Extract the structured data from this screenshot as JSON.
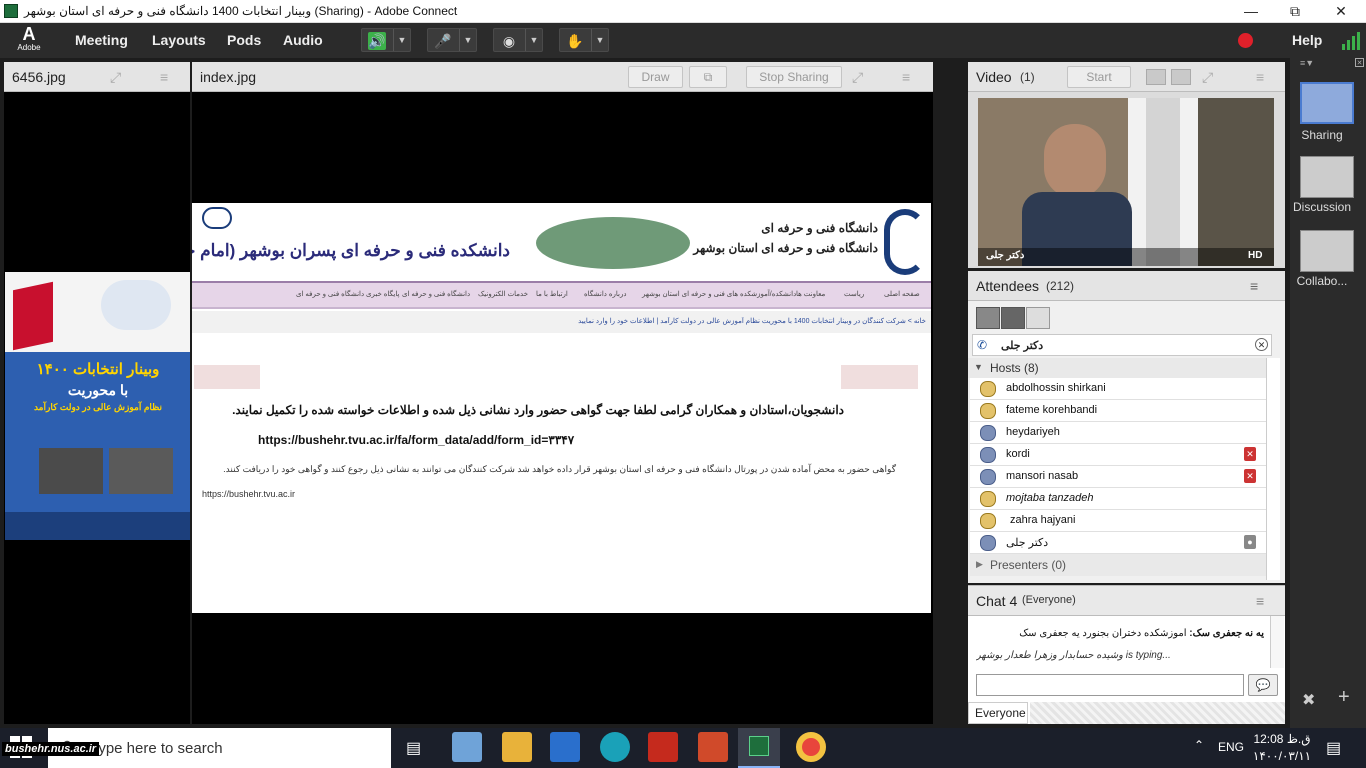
{
  "window": {
    "title": "وبینار انتخابات 1400 دانشگاه فنی و حرفه ای استان بوشهر (Sharing) - Adobe Connect"
  },
  "menubar": {
    "logo": "Adobe",
    "items": [
      "Meeting",
      "Layouts",
      "Pods",
      "Audio"
    ],
    "help": "Help"
  },
  "pods": {
    "left": {
      "title": "6456.jpg"
    },
    "share": {
      "title": "index.jpg",
      "draw": "Draw",
      "stop_sharing": "Stop Sharing"
    },
    "video": {
      "title": "Video",
      "count": "(1)",
      "start": "Start",
      "caption": "دکتر جلی",
      "hd": "HD"
    },
    "attendees": {
      "title": "Attendees",
      "count": "(212)",
      "presenter_name": "دکتر جلی",
      "hosts_label": "Hosts (8)",
      "hosts": [
        "abdolhossin shirkani",
        "fateme korehbandi",
        "heydariyeh",
        "kordi",
        "mansori nasab",
        "mojtaba tanzadeh",
        "zahra hajyani",
        "دکتر جلی"
      ],
      "presenters_label": "Presenters (0)"
    },
    "chat": {
      "title": "Chat 4",
      "scope": "(Everyone)",
      "message_sender": "یه نه جعفری سک:",
      "message_text": "آموزشکده دختران بجنورد یه جعفری سک",
      "typing": "وشیده حسابدار  وزهرا طعدار بوشهر is typing...",
      "input_placeholder": "",
      "recipient": "Everyone"
    }
  },
  "webpage": {
    "title_main": "دانشکده فنی و حرفه ای پسران بوشهر (امام خامنه ای)",
    "uni_line1": "دانشگاه فنی و حرفه ای",
    "uni_line2": "دانشگاه فنی و حرفه ای استان بوشهر",
    "nav": [
      "صفحه اصلی",
      "ریاست",
      "معاونت ها",
      "دانشکده/آموزشکده های فنی و حرفه ای استان بوشهر",
      "درباره دانشگاه",
      "ارتباط با ما",
      "خدمات الکترونیک",
      "دانشگاه فنی و حرفه ای",
      "پایگاه خبری دانشگاه فنی و حرفه ای"
    ],
    "breadcrumb": "خانه  >  شرکت کنندگان در وبینار انتخابات 1400 با محوریت نظام آموزش عالی در دولت کارآمد  |  اطلاعات خود را وارد نمایید",
    "heading": "دانشجویان،استادان و همکاران گرامی لطفا جهت گواهی حضور وارد نشانی ذیل شده و اطلاعات خواسته شده را تکمیل نمایند.",
    "link": "https://bushehr.tvu.ac.ir/fa/form_data/add/form_id=۳۳۴۷",
    "note": "گواهی حضور به محض آماده شدن در پورتال دانشگاه فنی و حرفه ای استان بوشهر قرار داده خواهد شد شرکت کنندگان می توانند به نشانی ذیل رجوع کنند و گواهی خود را دریافت کنند.",
    "url": "https://bushehr.tvu.ac.ir"
  },
  "poster": {
    "line1": "وبینار انتخابات ۱۴۰۰",
    "line2": "با محوریت",
    "line3": "نظام آموزش عالی در دولت کارآمد"
  },
  "side_layouts": [
    "Sharing",
    "Discussion",
    "Collabo..."
  ],
  "taskbar": {
    "search_placeholder": "Type here to search",
    "watermark": "bushehr.nus.ac.ir",
    "lang": "ENG",
    "time": "12:08 ق.ظ",
    "date": "۱۴۰۰/۰۳/۱۱"
  },
  "colors": {
    "record": "#e0202a",
    "menubar": "#2b2b2b",
    "pod_header": "#e4e4e4"
  }
}
